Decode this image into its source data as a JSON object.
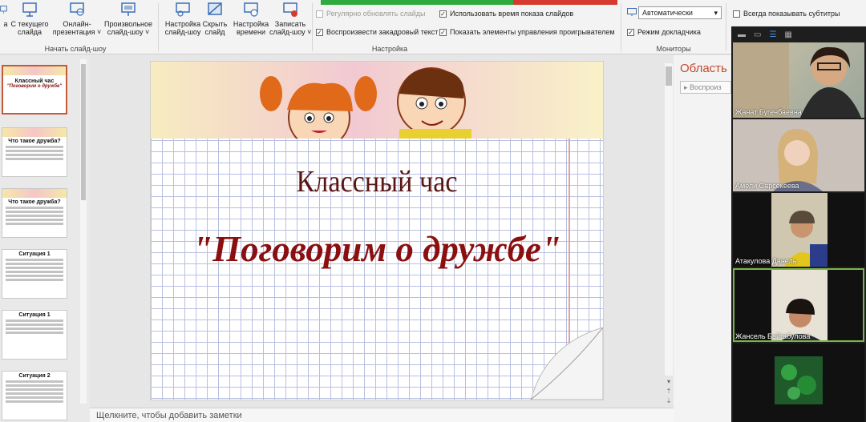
{
  "ribbon": {
    "start_group": {
      "label": "Начать слайд-шоу",
      "buttons": [
        {
          "label": "а",
          "icon": "slideshow-from-beginning-icon"
        },
        {
          "label": "С текущего\nслайда",
          "icon": "slideshow-current-icon"
        },
        {
          "label": "Онлайн-\nпрезентация ˅",
          "icon": "online-presentation-icon"
        },
        {
          "label": "Произвольное\nслайд-шоу ˅",
          "icon": "custom-slideshow-icon"
        }
      ]
    },
    "setup_group": {
      "label": "Настройка",
      "buttons": [
        {
          "label": "Настройка\nслайд-шоу",
          "icon": "setup-slideshow-icon"
        },
        {
          "label": "Скрыть\nслайд",
          "icon": "hide-slide-icon"
        },
        {
          "label": "Настройка\nвремени",
          "icon": "rehearse-timings-icon"
        },
        {
          "label": "Записать\nслайд-шоу ˅",
          "icon": "record-slideshow-icon"
        }
      ],
      "checks": [
        {
          "label": "Регулярно обновлять слайды",
          "checked": false,
          "disabled": true
        },
        {
          "label": "Воспроизвести закадровый текст",
          "checked": true,
          "disabled": false
        },
        {
          "label": "Использовать время показа слайдов",
          "checked": true,
          "disabled": false
        },
        {
          "label": "Показать элементы управления проигрывателем",
          "checked": true,
          "disabled": false
        }
      ]
    },
    "monitors_group": {
      "label": "Мониторы",
      "monitor_select": "Автоматически",
      "presenter_view": "Режим докладчика",
      "presenter_checked": true
    },
    "captions": {
      "label": "Всегда показывать субтитры",
      "checked": false
    }
  },
  "thumbnails": [
    {
      "title": "Классный час",
      "subtitle": "\"Поговорим о дружбе\"",
      "selected": true
    },
    {
      "title": "Что такое дружба?",
      "subtitle": "",
      "selected": false
    },
    {
      "title": "Что такое дружба?",
      "subtitle": "",
      "selected": false
    },
    {
      "title": "Ситуация 1",
      "subtitle": "",
      "selected": false
    },
    {
      "title": "Ситуация 1",
      "subtitle": "",
      "selected": false
    },
    {
      "title": "Ситуация 2",
      "subtitle": "",
      "selected": false
    }
  ],
  "slide": {
    "title": "Классный час",
    "subtitle": "\"Поговорим о дружбе\""
  },
  "notes_placeholder": "Щелкните, чтобы добавить заметки",
  "pane": {
    "title": "Область",
    "button": "Воспроиз"
  },
  "zoom": {
    "participants": [
      {
        "name": "Жанат Бугенбаевна",
        "speaker": false
      },
      {
        "name": "Амели Сарсекеева",
        "speaker": false
      },
      {
        "name": "Атакулова Данель",
        "speaker": false
      },
      {
        "name": "Жансель Байгабулова",
        "speaker": true
      },
      {
        "name": "",
        "speaker": false
      }
    ]
  },
  "colors": {
    "accent": "#c24a2e",
    "title_dark": "#5a1414",
    "title_red": "#8b0f0f",
    "speaker_border": "#7ab548"
  }
}
